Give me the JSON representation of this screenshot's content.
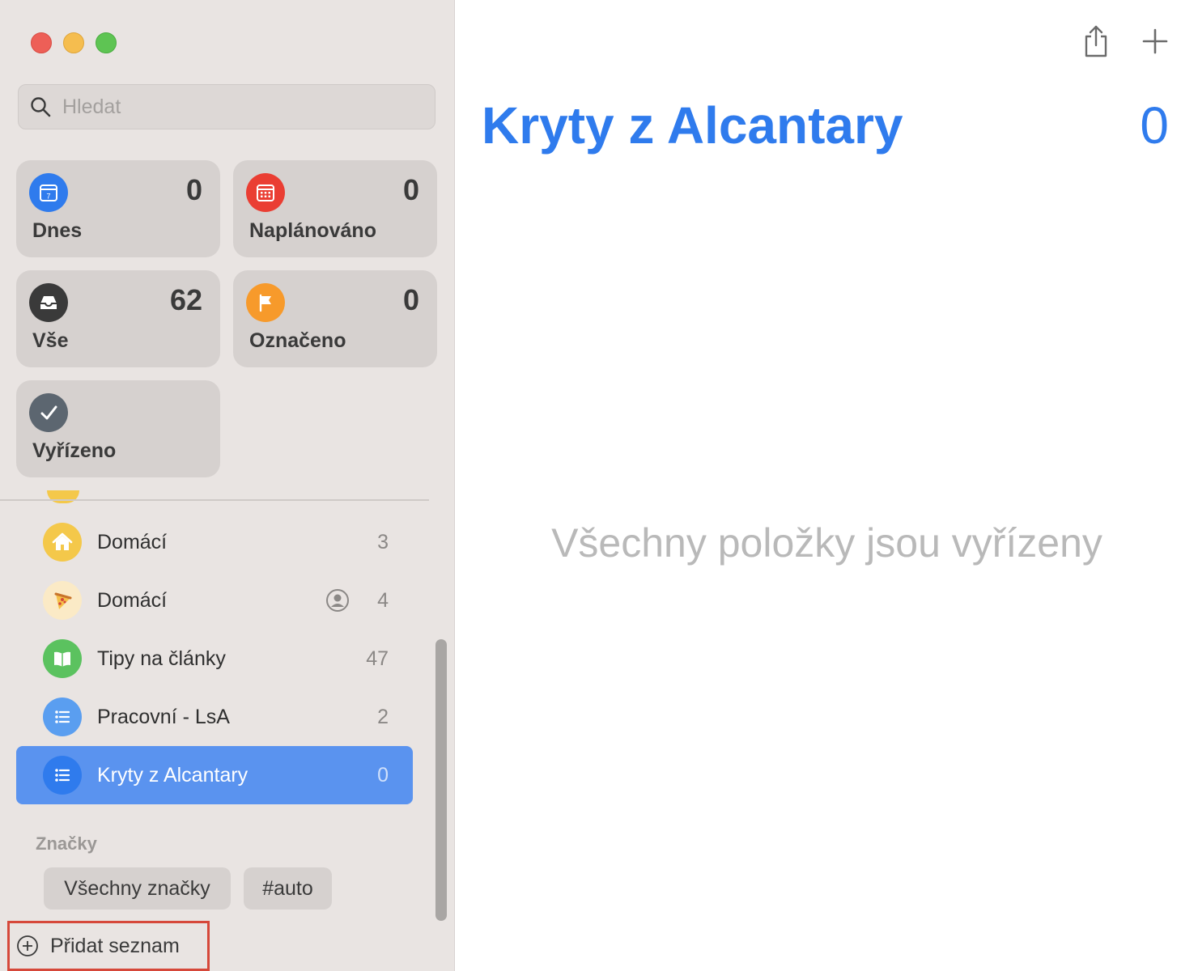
{
  "search": {
    "placeholder": "Hledat"
  },
  "smart_lists": [
    {
      "label": "Dnes",
      "count": "0",
      "icon": "calendar-today-icon",
      "color": "#2f7bed",
      "day": "7"
    },
    {
      "label": "Naplánováno",
      "count": "0",
      "icon": "calendar-scheduled-icon",
      "color": "#ea3e33"
    },
    {
      "label": "Vše",
      "count": "62",
      "icon": "tray-icon",
      "color": "#3a3a3a"
    },
    {
      "label": "Označeno",
      "count": "0",
      "icon": "flag-icon",
      "color": "#f79a2b"
    },
    {
      "label": "Vyřízeno",
      "icon": "checkmark-icon",
      "color": "#5c6670"
    }
  ],
  "lists": [
    {
      "name": "Domácí",
      "count": "3",
      "icon": "house-icon",
      "color": "#f4c84a"
    },
    {
      "name": "Domácí",
      "count": "4",
      "icon": "pizza-icon",
      "color": "#fbeac6",
      "shared": true
    },
    {
      "name": "Tipy na články",
      "count": "47",
      "icon": "book-icon",
      "color": "#5bc25f"
    },
    {
      "name": "Pracovní - LsA",
      "count": "2",
      "icon": "list-icon",
      "color": "#5a9ef0"
    },
    {
      "name": "Kryty z Alcantary",
      "count": "0",
      "icon": "list-icon",
      "color": "#2f7bed",
      "selected": true
    }
  ],
  "tags": {
    "label": "Značky",
    "items": [
      "Všechny značky",
      "#auto"
    ]
  },
  "add_list_label": "Přidat seznam",
  "main": {
    "title": "Kryty z Alcantary",
    "count": "0",
    "empty_message": "Všechny položky jsou vyřízeny"
  },
  "colors": {
    "accent": "#2f7bed",
    "selected_row": "#5a93ef",
    "highlight_box": "#d6483a"
  }
}
